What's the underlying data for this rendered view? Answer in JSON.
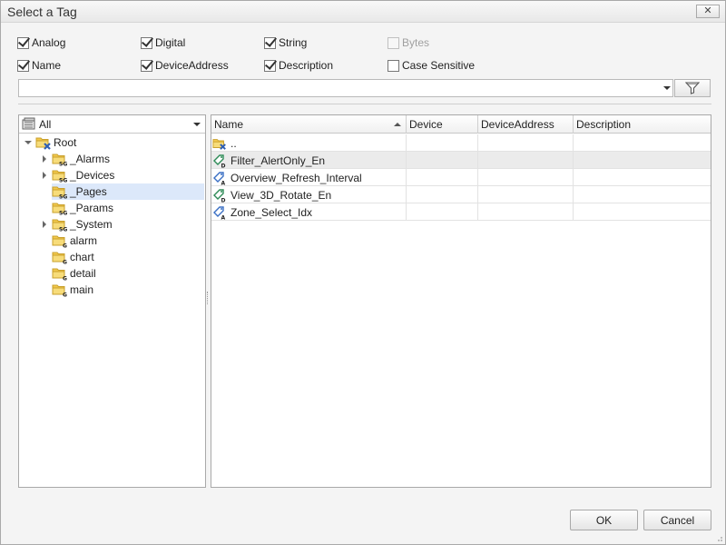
{
  "window": {
    "title": "Select a Tag",
    "close_glyph": "✕"
  },
  "filters": {
    "analog": {
      "label": "Analog",
      "checked": true
    },
    "digital": {
      "label": "Digital",
      "checked": true
    },
    "string": {
      "label": "String",
      "checked": true
    },
    "bytes": {
      "label": "Bytes",
      "checked": false,
      "disabled": true
    },
    "name": {
      "label": "Name",
      "checked": true
    },
    "device_address": {
      "label": "DeviceAddress",
      "checked": true
    },
    "description": {
      "label": "Description",
      "checked": true
    },
    "case_sensitive": {
      "label": "Case Sensitive",
      "checked": false
    }
  },
  "search": {
    "value": "",
    "placeholder": ""
  },
  "tree": {
    "scope_label": "All",
    "nodes": [
      {
        "label": "Root",
        "badge": "",
        "expander": "down",
        "selected": false
      },
      {
        "label": "_Alarms",
        "badge": "SG",
        "expander": "right",
        "selected": false
      },
      {
        "label": "_Devices",
        "badge": "SG",
        "expander": "right",
        "selected": false
      },
      {
        "label": "_Pages",
        "badge": "SG",
        "expander": "",
        "selected": true
      },
      {
        "label": "_Params",
        "badge": "SG",
        "expander": "",
        "selected": false
      },
      {
        "label": "_System",
        "badge": "SG",
        "expander": "right",
        "selected": false
      },
      {
        "label": "alarm",
        "badge": "G",
        "expander": "",
        "selected": false
      },
      {
        "label": "chart",
        "badge": "G",
        "expander": "",
        "selected": false
      },
      {
        "label": "detail",
        "badge": "G",
        "expander": "",
        "selected": false
      },
      {
        "label": "main",
        "badge": "G",
        "expander": "",
        "selected": false
      }
    ]
  },
  "grid": {
    "columns": [
      "Name",
      "Device",
      "DeviceAddress",
      "Description"
    ],
    "sorted_column": "Name",
    "rows": [
      {
        "name": "..",
        "type": "up",
        "device": "",
        "device_address": "",
        "description": "",
        "selected": false
      },
      {
        "name": "Filter_AlertOnly_En",
        "type": "D",
        "device": "",
        "device_address": "",
        "description": "",
        "selected": true
      },
      {
        "name": "Overview_Refresh_Interval",
        "type": "A",
        "device": "",
        "device_address": "",
        "description": "",
        "selected": false
      },
      {
        "name": "View_3D_Rotate_En",
        "type": "D",
        "device": "",
        "device_address": "",
        "description": "",
        "selected": false
      },
      {
        "name": "Zone_Select_Idx",
        "type": "A",
        "device": "",
        "device_address": "",
        "description": "",
        "selected": false
      }
    ]
  },
  "buttons": {
    "ok": "OK",
    "cancel": "Cancel"
  },
  "colors": {
    "folder": "#f2c94c",
    "folder_edge": "#c9a02c",
    "selection": "#dce8fa",
    "tag_digital": "#2e8b57",
    "tag_analog": "#3a6fc4"
  }
}
